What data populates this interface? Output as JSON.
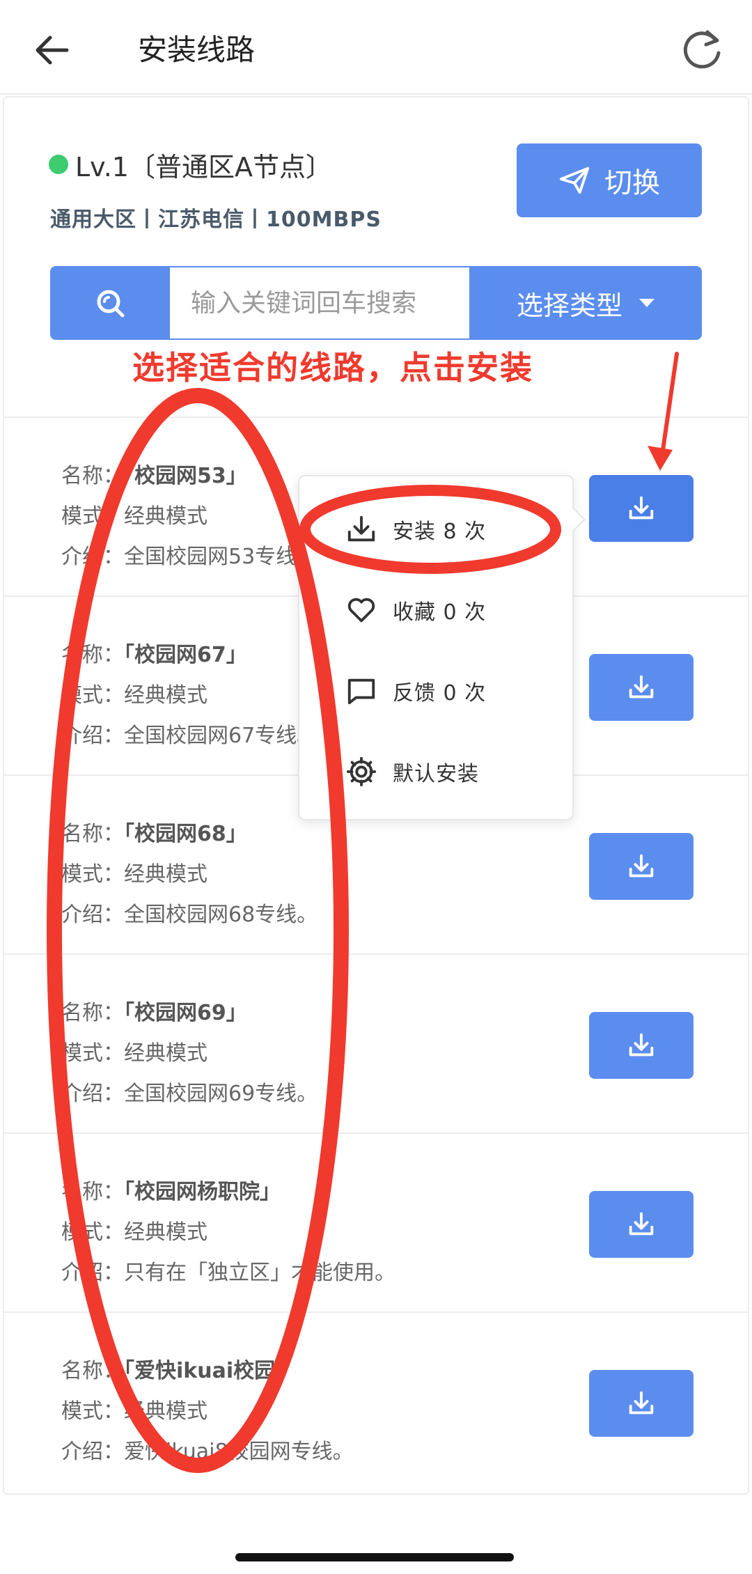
{
  "header": {
    "title": "安装线路"
  },
  "node": {
    "title": "Lv.1〔普通区A节点〕",
    "subtitle": "通用大区丨江苏电信丨100MBPS",
    "switch_label": "切换",
    "status_color": "#3dcc6e"
  },
  "search": {
    "placeholder": "输入关键词回车搜索",
    "type_select_label": "选择类型"
  },
  "annotation": {
    "text": "选择适合的线路，点击安装",
    "color": "#f03a2e"
  },
  "routes": [
    {
      "name_label": "名称：",
      "name": "「校园网53」",
      "mode_label": "模式：",
      "mode": "经典模式",
      "desc_label": "介绍：",
      "desc": "全国校园网53专线。"
    },
    {
      "name_label": "名称：",
      "name": "「校园网67」",
      "mode_label": "模式：",
      "mode": "经典模式",
      "desc_label": "介绍：",
      "desc": "全国校园网67专线。"
    },
    {
      "name_label": "名称：",
      "name": "「校园网68」",
      "mode_label": "模式：",
      "mode": "经典模式",
      "desc_label": "介绍：",
      "desc": "全国校园网68专线。"
    },
    {
      "name_label": "名称：",
      "name": "「校园网69」",
      "mode_label": "模式：",
      "mode": "经典模式",
      "desc_label": "介绍：",
      "desc": "全国校园网69专线。"
    },
    {
      "name_label": "名称：",
      "name": "「校园网杨职院」",
      "mode_label": "模式：",
      "mode": "经典模式",
      "desc_label": "介绍：",
      "desc": "只有在「独立区」才能使用。"
    },
    {
      "name_label": "名称：",
      "name": "「爱快ikuai校园」",
      "mode_label": "模式：",
      "mode": "经典模式",
      "desc_label": "介绍：",
      "desc": "爱快ikuai8校园网专线。"
    }
  ],
  "popover": {
    "install": "安装 8 次",
    "favorite": "收藏 0 次",
    "feedback": "反馈 0 次",
    "default_install": "默认安装"
  },
  "colors": {
    "primary": "#5b8def",
    "annotation_red": "#f03a2e"
  },
  "icons": [
    "back-arrow-icon",
    "refresh-icon",
    "send-icon",
    "search-icon",
    "download-icon",
    "heart-icon",
    "comment-icon",
    "gear-icon"
  ]
}
